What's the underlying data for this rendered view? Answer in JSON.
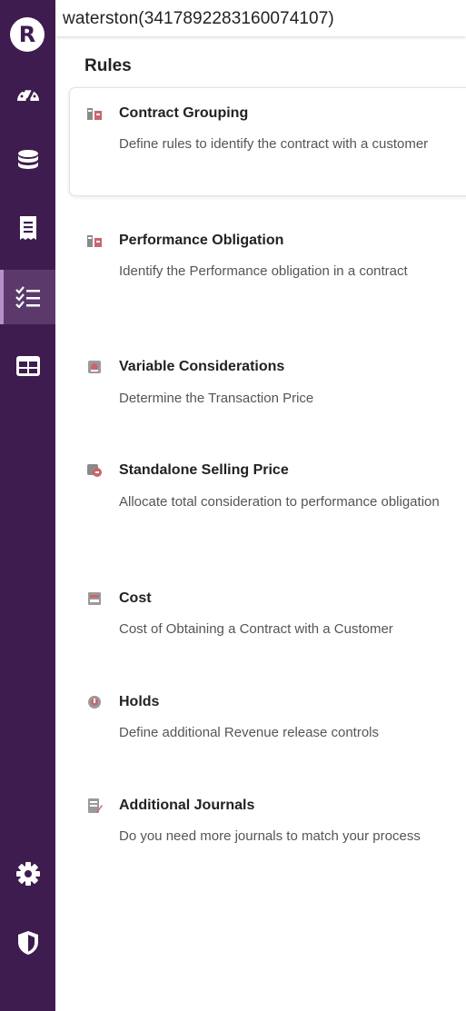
{
  "app": {
    "logo_letter": "R"
  },
  "topbar": {
    "tenant_label": "waterston(3417892283160074107)"
  },
  "page": {
    "title": "Rules"
  },
  "sidebar": {
    "items": [
      {
        "icon": "dashboard-icon"
      },
      {
        "icon": "database-icon"
      },
      {
        "icon": "receipt-icon"
      },
      {
        "icon": "rules-checklist-icon",
        "active": true
      },
      {
        "icon": "table-icon"
      },
      {
        "icon": "gear-icon"
      },
      {
        "icon": "shield-icon"
      }
    ]
  },
  "colors": {
    "sidebar_bg": "#3e1c4f",
    "sidebar_active": "#5b3a6b"
  },
  "rules": [
    {
      "title": "Contract Grouping",
      "description": "Define rules to identify the contract with a customer",
      "icon": "contract-grouping-icon"
    },
    {
      "title": "Performance Obligation",
      "description": "Identify the Performance obligation in a contract",
      "icon": "performance-obligation-icon"
    },
    {
      "title": "Variable Considerations",
      "description": "Determine the Transaction Price",
      "icon": "variable-considerations-icon"
    },
    {
      "title": "Standalone Selling Price",
      "description": "Allocate total consideration to performance obligation",
      "icon": "standalone-selling-price-icon"
    },
    {
      "title": "Cost",
      "description": "Cost of Obtaining a Contract with a Customer",
      "icon": "cost-icon"
    },
    {
      "title": "Holds",
      "description": "Define additional Revenue release controls",
      "icon": "holds-icon"
    },
    {
      "title": "Additional Journals",
      "description": "Do you need more journals to match your process",
      "icon": "additional-journals-icon"
    }
  ]
}
